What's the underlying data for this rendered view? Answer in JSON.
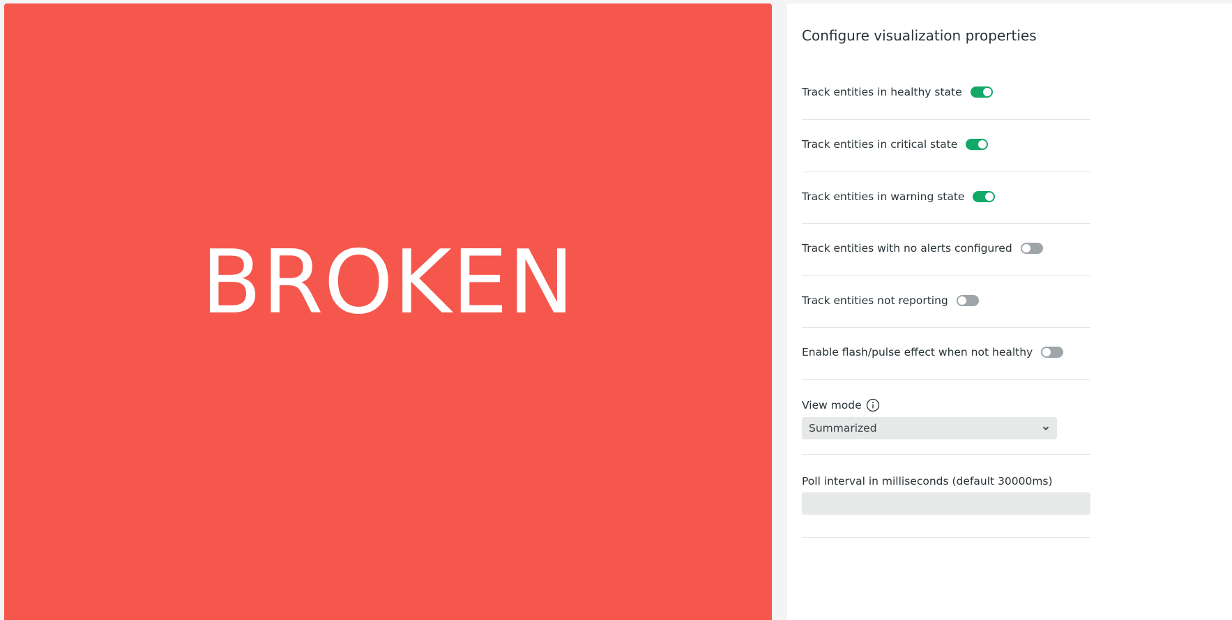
{
  "preview": {
    "status_text": "BROKEN",
    "background_color": "#f5574d"
  },
  "panel": {
    "title": "Configure visualization properties",
    "toggles": [
      {
        "label": "Track entities in healthy state",
        "enabled": true
      },
      {
        "label": "Track entities in critical state",
        "enabled": true
      },
      {
        "label": "Track entities in warning state",
        "enabled": true
      },
      {
        "label": "Track entities with no alerts configured",
        "enabled": false
      },
      {
        "label": "Track entities not reporting",
        "enabled": false
      },
      {
        "label": "Enable flash/pulse effect when not healthy",
        "enabled": false
      }
    ],
    "view_mode": {
      "label": "View mode",
      "icon": "info-icon",
      "selected": "Summarized",
      "dropdown_icon": "chevron-down-icon"
    },
    "poll_interval": {
      "label": "Poll interval in milliseconds (default 30000ms)",
      "value": ""
    }
  },
  "colors": {
    "toggle_on": "#11a868",
    "toggle_off": "#9ea5a9",
    "text": "#293338"
  }
}
